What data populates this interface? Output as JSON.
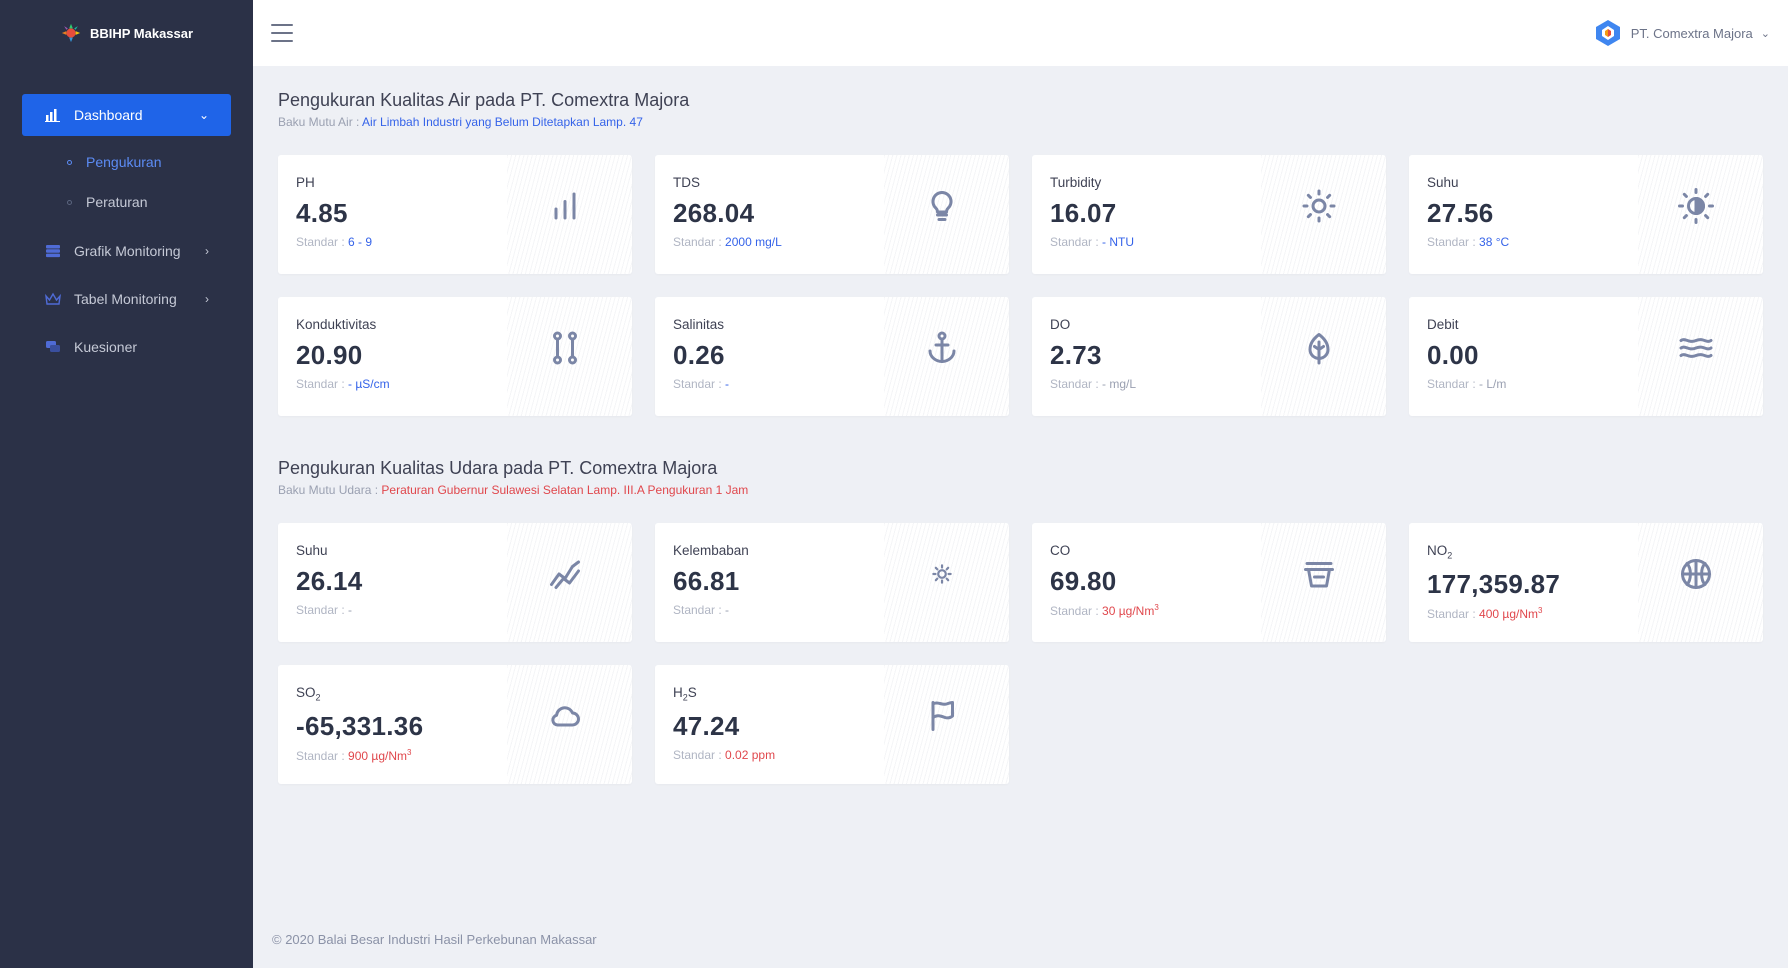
{
  "brand": {
    "name": "BBIHP Makassar"
  },
  "sidebar": {
    "dashboard": "Dashboard",
    "sub_items": [
      "Pengukuran",
      "Peraturan"
    ],
    "grafik": "Grafik Monitoring",
    "tabel": "Tabel Monitoring",
    "kuesioner": "Kuesioner"
  },
  "topbar": {
    "user": "PT. Comextra Majora"
  },
  "water": {
    "title": "Pengukuran Kualitas Air pada PT. Comextra Majora",
    "sub_prefix": "Baku Mutu Air :",
    "sub_link": "Air Limbah Industri yang Belum Ditetapkan Lamp. 47",
    "cards": [
      {
        "label": "PH",
        "value": "4.85",
        "std_prefix": "Standar :",
        "std_value": "6 - 9",
        "icon": "bar-chart-icon"
      },
      {
        "label": "TDS",
        "value": "268.04",
        "std_prefix": "Standar :",
        "std_value": "2000 mg/L",
        "icon": "bulb-icon"
      },
      {
        "label": "Turbidity",
        "value": "16.07",
        "std_prefix": "Standar :",
        "std_value": "- NTU",
        "icon": "sun-icon"
      },
      {
        "label": "Suhu",
        "value": "27.56",
        "std_prefix": "Standar :",
        "std_value": "38 °C",
        "icon": "brightness-icon"
      },
      {
        "label": "Konduktivitas",
        "value": "20.90",
        "std_prefix": "Standar :",
        "std_value": "- µS/cm",
        "icon": "route-icon"
      },
      {
        "label": "Salinitas",
        "value": "0.26",
        "std_prefix": "Standar :",
        "std_value": "-",
        "icon": "anchor-icon"
      },
      {
        "label": "DO",
        "value": "2.73",
        "std_prefix": "Standar :",
        "std_value": "- mg/L",
        "icon": "leaf-icon"
      },
      {
        "label": "Debit",
        "value": "0.00",
        "std_prefix": "Standar :",
        "std_value": "- L/m",
        "icon": "waves-icon"
      }
    ]
  },
  "air": {
    "title": "Pengukuran Kualitas Udara pada PT. Comextra Majora",
    "sub_prefix": "Baku Mutu Udara :",
    "sub_link": "Peraturan Gubernur Sulawesi Selatan Lamp. III.A Pengukuran 1 Jam",
    "cards": [
      {
        "label": "Suhu",
        "value": "26.14",
        "std_prefix": "Standar :",
        "std_value": "-",
        "icon": "trend-icon"
      },
      {
        "label": "Kelembaban",
        "value": "66.81",
        "std_prefix": "Standar :",
        "std_value": "-",
        "icon": "small-sun-icon"
      },
      {
        "label": "CO",
        "value": "69.80",
        "std_prefix": "Standar :",
        "std_value": "30 µg/Nm",
        "std_sup": "3",
        "icon": "bucket-icon"
      },
      {
        "label_main": "NO",
        "label_sub": "2",
        "value": "177,359.87",
        "std_prefix": "Standar :",
        "std_value": "400 µg/Nm",
        "std_sup": "3",
        "icon": "basketball-icon"
      },
      {
        "label_main": "SO",
        "label_sub": "2",
        "value": "-65,331.36",
        "std_prefix": "Standar :",
        "std_value": "900 µg/Nm",
        "std_sup": "3",
        "icon": "cloud-icon"
      },
      {
        "label_main": "H",
        "label_sub": "2",
        "label_tail": "S",
        "value": "47.24",
        "std_prefix": "Standar :",
        "std_value": "0.02 ppm",
        "icon": "flag-icon"
      }
    ]
  },
  "footer": "© 2020 Balai Besar Industri Hasil Perkebunan Makassar",
  "colors": {
    "sidebar": "#2b3147",
    "accent": "#1f64e8",
    "link_blue": "#3563e9",
    "link_red": "#e0474c",
    "background": "#eef0f5"
  }
}
